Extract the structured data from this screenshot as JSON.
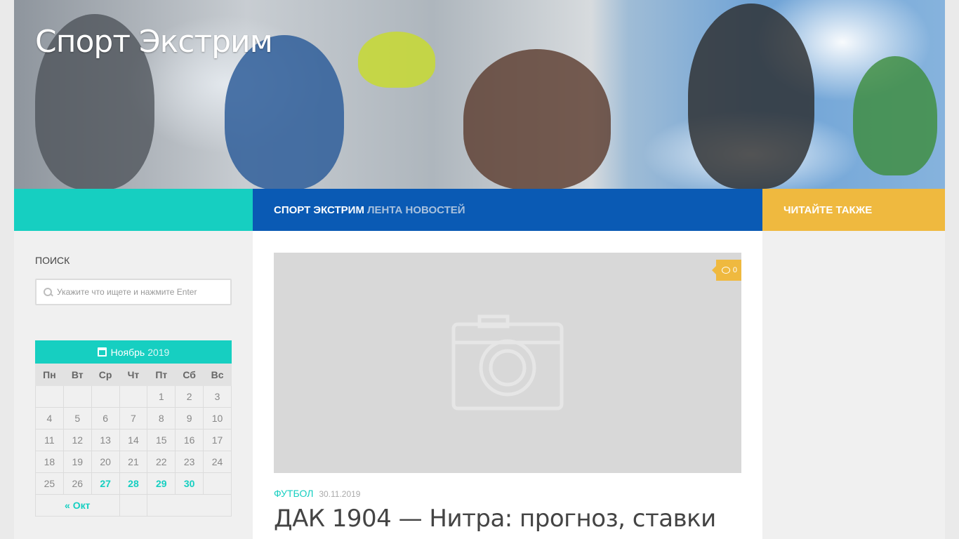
{
  "site": {
    "title": "Спорт Экстрим"
  },
  "nav": {
    "items": [
      {
        "label": "СПОРТ ЭКСТРИМ"
      },
      {
        "label": "ЛЕНТА НОВОСТЕЙ"
      }
    ],
    "right_label": "ЧИТАЙТЕ ТАКЖЕ"
  },
  "sidebar": {
    "search": {
      "title": "ПОИСК",
      "placeholder": "Укажите что ищете и нажмите Enter",
      "icon": "search-icon"
    },
    "calendar": {
      "month": "Ноябрь",
      "year": "2019",
      "icon": "calendar-icon",
      "weekdays": [
        "Пн",
        "Вт",
        "Ср",
        "Чт",
        "Пт",
        "Сб",
        "Вс"
      ],
      "weeks": [
        [
          "",
          "",
          "",
          "",
          "1",
          "2",
          "3"
        ],
        [
          "4",
          "5",
          "6",
          "7",
          "8",
          "9",
          "10"
        ],
        [
          "11",
          "12",
          "13",
          "14",
          "15",
          "16",
          "17"
        ],
        [
          "18",
          "19",
          "20",
          "21",
          "22",
          "23",
          "24"
        ],
        [
          "25",
          "26",
          "27",
          "28",
          "29",
          "30",
          ""
        ]
      ],
      "linked_days": [
        "27",
        "28",
        "29",
        "30"
      ],
      "prev_label": "« Окт"
    }
  },
  "post": {
    "comment_count": "0",
    "category": "ФУТБОЛ",
    "date": "30.11.2019",
    "title": "ДАК 1904 — Нитра: прогноз, ставки"
  },
  "colors": {
    "teal": "#16cfc1",
    "blue": "#0a5ab4",
    "yellow": "#efb93f"
  }
}
